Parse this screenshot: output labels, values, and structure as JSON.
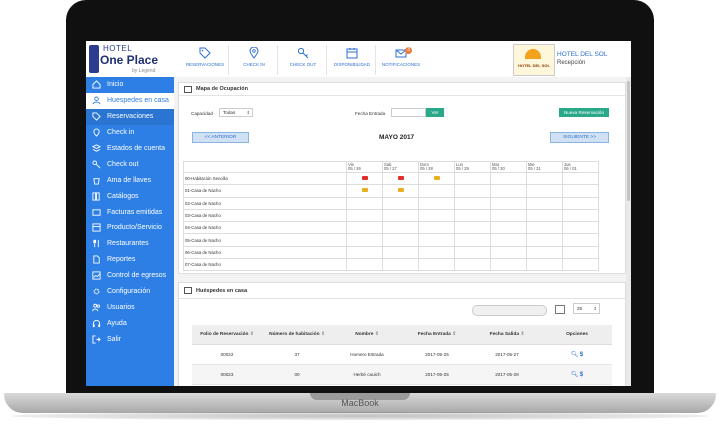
{
  "laptop": {
    "brand_label": "MacBook"
  },
  "logo": {
    "hotel": "HOTEL",
    "one_place": "One Place",
    "legend": "by Legend"
  },
  "topnav": [
    {
      "label": "RESERVACIONES",
      "icon": "tag-icon"
    },
    {
      "label": "CHECK IN",
      "icon": "location-pin-icon"
    },
    {
      "label": "CHECK OUT",
      "icon": "key-icon"
    },
    {
      "label": "DISPONIBILIDAD",
      "icon": "calendar-icon"
    },
    {
      "label": "NOTIFICACIONES",
      "icon": "envelope-icon",
      "badge": "3"
    }
  ],
  "hotel": {
    "logo_text": "HOTEL DEL SOL",
    "name": "HOTEL DEL SOL",
    "role": "Recepción"
  },
  "sidebar": {
    "items": [
      {
        "label": "Inicio",
        "icon": "home-icon"
      },
      {
        "label": "Huespedes en casa",
        "icon": "user-icon",
        "active": true
      },
      {
        "label": "Reservaciones",
        "icon": "tag-icon"
      },
      {
        "label": "Check in",
        "icon": "location-pin-icon"
      },
      {
        "label": "Estados de cuenta",
        "icon": "layers-icon"
      },
      {
        "label": "Check out",
        "icon": "key-icon"
      },
      {
        "label": "Ama de llaves",
        "icon": "bucket-icon"
      },
      {
        "label": "Catálogos",
        "icon": "books-icon"
      },
      {
        "label": "Facturas emitidas",
        "icon": "invoice-icon"
      },
      {
        "label": "Producto/Servicio",
        "icon": "box-icon"
      },
      {
        "label": "Restaurantes",
        "icon": "cutlery-icon"
      },
      {
        "label": "Reportes",
        "icon": "document-icon"
      },
      {
        "label": "Control de egresos",
        "icon": "chart-icon"
      },
      {
        "label": "Configuración",
        "icon": "gear-icon"
      },
      {
        "label": "Usuarios",
        "icon": "users-icon"
      },
      {
        "label": "Ayuda",
        "icon": "headset-icon"
      },
      {
        "label": "Salir",
        "icon": "exit-icon"
      }
    ]
  },
  "occupancy": {
    "title": "Mapa de Ocupación",
    "capacity_label": "Capacidad",
    "capacity_value": "Todas",
    "date_label": "Fecha Entrada",
    "date_value": "",
    "go_button": "Ver",
    "new_button": "Nueva Reservación",
    "prev_button": "<< ANTERIOR",
    "next_button": "SIGUIENTE >>",
    "month": "MAYO 2017",
    "days": [
      {
        "dow": "Vie",
        "date": "05 / 26"
      },
      {
        "dow": "Sab",
        "date": "05 / 27"
      },
      {
        "dow": "Dom",
        "date": "05 / 28"
      },
      {
        "dow": "Lun",
        "date": "05 / 29"
      },
      {
        "dow": "Mar",
        "date": "05 / 30"
      },
      {
        "dow": "Mie",
        "date": "05 / 31"
      },
      {
        "dow": "Jue",
        "date": "06 / 01"
      }
    ],
    "rooms": [
      {
        "label": "00-Habitación Sencilla",
        "tags": [
          {
            "day": 0,
            "color": "#e0302a"
          },
          {
            "day": 1,
            "color": "#e0302a"
          },
          {
            "day": 2,
            "color": "#e8b020"
          }
        ]
      },
      {
        "label": "01-Casa de Nacho",
        "tags": [
          {
            "day": 0,
            "color": "#e8b020"
          },
          {
            "day": 1,
            "color": "#e8b020"
          }
        ]
      },
      {
        "label": "02-Casa de Nacho",
        "tags": []
      },
      {
        "label": "03-Casa de Nacho",
        "tags": []
      },
      {
        "label": "04-Casa de Nacho",
        "tags": []
      },
      {
        "label": "05-Casa de Nacho",
        "tags": []
      },
      {
        "label": "06-Casa de Nacho",
        "tags": []
      },
      {
        "label": "07-Casa de Nacho",
        "tags": []
      }
    ]
  },
  "guests": {
    "title": "Huéspedes en casa",
    "page_size": "25",
    "columns": [
      "Folio de Reservación",
      "Número de habitación",
      "Nombre",
      "Fecha Entrada",
      "Fecha Salida",
      "Opciones"
    ],
    "rows": [
      {
        "folio": "00022",
        "room": "37",
        "name": "Homero Estrada",
        "in": "2017-05-25",
        "out": "2017-05-27"
      },
      {
        "folio": "00023",
        "room": "00",
        "name": "Herbé cauich",
        "in": "2017-05-25",
        "out": "2017-05-28"
      }
    ]
  },
  "colors": {
    "accent": "#2d7fe6",
    "green": "#2aa88a",
    "red_tag": "#e0302a",
    "yellow_tag": "#e8b020"
  }
}
